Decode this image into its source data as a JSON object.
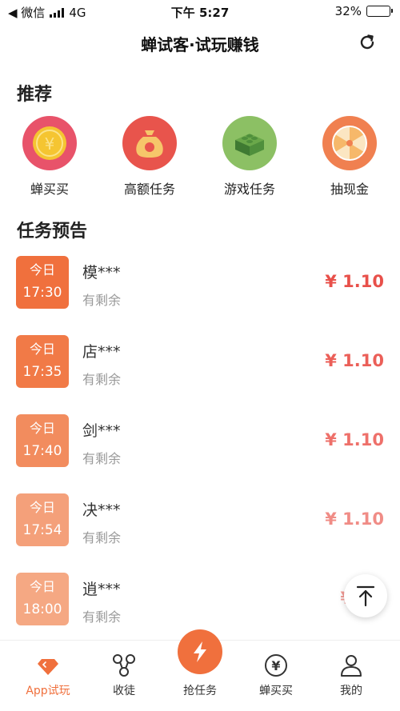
{
  "status_bar": {
    "back_app": "◀ 微信",
    "network": "4G",
    "time": "下午 5:27",
    "battery": "32%",
    "battery_level": 0.32
  },
  "header": {
    "title": "蝉试客·试玩赚钱",
    "refresh_icon": "refresh-icon"
  },
  "recommend": {
    "title": "推荐",
    "items": [
      {
        "label": "蝉买买",
        "icon": "coin-icon",
        "color": "#e8536a"
      },
      {
        "label": "高额任务",
        "icon": "money-bag-icon",
        "color": "#e8544c"
      },
      {
        "label": "游戏任务",
        "icon": "brick-icon",
        "color": "#8cc064"
      },
      {
        "label": "抽现金",
        "icon": "wheel-icon",
        "color": "#f08050"
      }
    ]
  },
  "preview": {
    "title": "任务预告",
    "tasks": [
      {
        "day": "今日",
        "time": "17:30",
        "name": "模***",
        "remain": "有剩余",
        "price": "¥ 1.10"
      },
      {
        "day": "今日",
        "time": "17:35",
        "name": "店***",
        "remain": "有剩余",
        "price": "¥ 1.10"
      },
      {
        "day": "今日",
        "time": "17:40",
        "name": "剑***",
        "remain": "有剩余",
        "price": "¥ 1.10"
      },
      {
        "day": "今日",
        "time": "17:54",
        "name": "决***",
        "remain": "有剩余",
        "price": "¥ 1.10"
      },
      {
        "day": "今日",
        "time": "18:00",
        "name": "逍***",
        "remain": "有剩余",
        "price": "¥"
      }
    ]
  },
  "tabs": [
    {
      "label": "App试玩",
      "icon": "diamond-icon",
      "active": true
    },
    {
      "label": "收徒",
      "icon": "share-icon",
      "active": false
    },
    {
      "label": "抢任务",
      "icon": "lightning-icon",
      "active": false
    },
    {
      "label": "蝉买买",
      "icon": "yen-icon",
      "active": false
    },
    {
      "label": "我的",
      "icon": "user-icon",
      "active": false
    }
  ],
  "colors": {
    "accent": "#f0703d",
    "price": "#e8504a"
  }
}
